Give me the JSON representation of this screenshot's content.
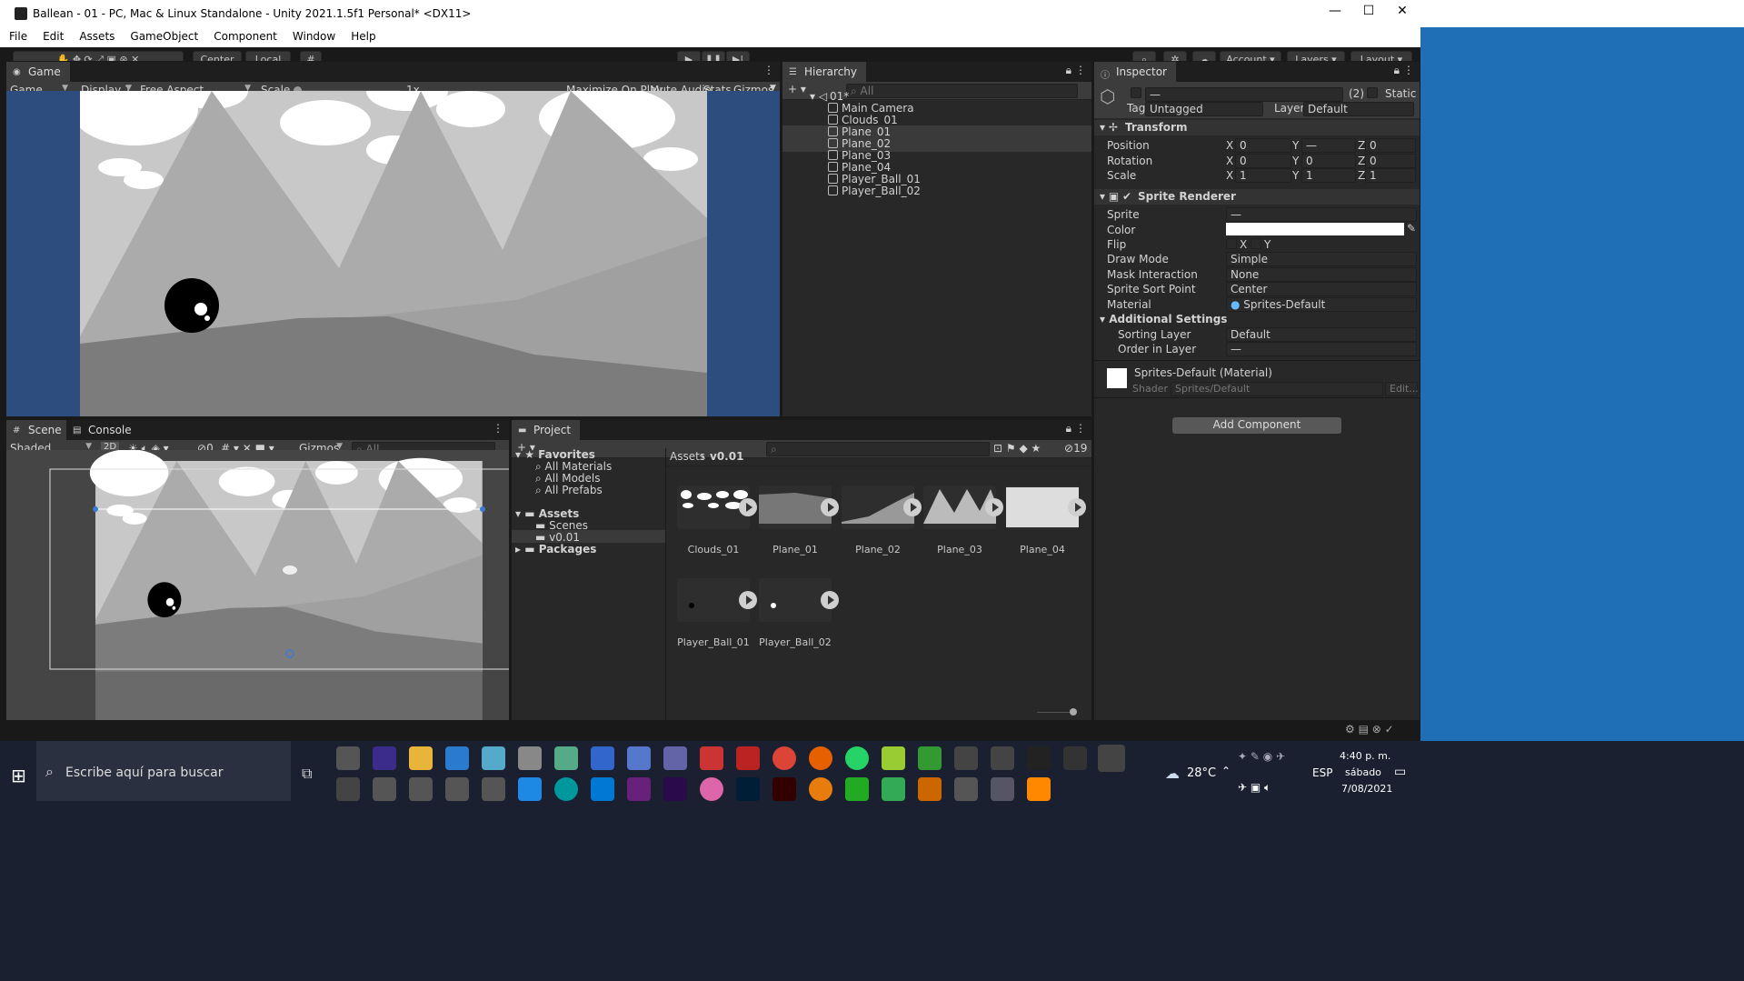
{
  "window": {
    "title": "Ballean - 01 - PC, Mac & Linux Standalone - Unity 2021.1.5f1 Personal* <DX11>",
    "minimize": "—",
    "maximize": "☐",
    "close": "✕"
  },
  "menu": [
    "File",
    "Edit",
    "Assets",
    "GameObject",
    "Component",
    "Window",
    "Help"
  ],
  "toolbar": {
    "pivot": "Center",
    "space": "Local",
    "account": "Account",
    "layers": "Layers",
    "layout": "Layout"
  },
  "game": {
    "tab": "Game",
    "view": "Game",
    "display": "Display 1",
    "aspect": "Free Aspect",
    "scale_label": "Scale",
    "scale_value": "1x",
    "maximize": "Maximize On Play",
    "mute": "Mute Audio",
    "stats": "Stats",
    "gizmos": "Gizmos"
  },
  "scene": {
    "tab": "Scene",
    "console_tab": "Console",
    "shading": "Shaded",
    "mode2d": "2D",
    "hidden_count": "0",
    "gizmos": "Gizmos",
    "search": "All"
  },
  "hierarchy": {
    "tab": "Hierarchy",
    "search": "All",
    "scene": "01*",
    "items": [
      "Main Camera",
      "Clouds_01",
      "Plane_01",
      "Plane_02",
      "Plane_03",
      "Plane_04",
      "Player_Ball_01",
      "Player_Ball_02"
    ]
  },
  "project": {
    "tab": "Project",
    "favorites": "Favorites",
    "fav_items": [
      "All Materials",
      "All Models",
      "All Prefabs"
    ],
    "assets": "Assets",
    "folders": [
      "Scenes",
      "v0.01"
    ],
    "packages": "Packages",
    "breadcrumb_root": "Assets",
    "breadcrumb_leaf": "v0.01",
    "count": "19",
    "asset_items": [
      "Clouds_01",
      "Plane_01",
      "Plane_02",
      "Plane_03",
      "Plane_04",
      "Player_Ball_01",
      "Player_Ball_02"
    ]
  },
  "inspector": {
    "tab": "Inspector",
    "name": "—",
    "count": "(2)",
    "static": "Static",
    "tag_label": "Tag",
    "tag": "Untagged",
    "layer_label": "Layer",
    "layer": "Default",
    "transform": {
      "title": "Transform",
      "position": "Position",
      "rotation": "Rotation",
      "scale": "Scale",
      "pos": {
        "x": "0",
        "y": "—",
        "z": "0"
      },
      "rot": {
        "x": "0",
        "y": "0",
        "z": "0"
      },
      "scl": {
        "x": "1",
        "y": "1",
        "z": "1"
      },
      "xl": "X",
      "yl": "Y",
      "zl": "Z"
    },
    "sprite": {
      "title": "Sprite Renderer",
      "sprite": "Sprite",
      "sprite_val": "—",
      "color": "Color",
      "flip": "Flip",
      "flip_x": "X",
      "flip_y": "Y",
      "draw_mode": "Draw Mode",
      "draw_mode_val": "Simple",
      "mask": "Mask Interaction",
      "mask_val": "None",
      "sort_point": "Sprite Sort Point",
      "sort_point_val": "Center",
      "material": "Material",
      "material_val": "Sprites-Default",
      "additional": "Additional Settings",
      "sorting_layer": "Sorting Layer",
      "sorting_layer_val": "Default",
      "order": "Order in Layer",
      "order_val": "—"
    },
    "mat": {
      "title": "Sprites-Default (Material)",
      "shader_label": "Shader",
      "shader": "Sprites/Default",
      "edit": "Edit..."
    },
    "add_component": "Add Component"
  },
  "taskbar": {
    "search": "Escribe aquí para buscar",
    "temp": "28°C",
    "lang": "ESP",
    "time": "4:40 p. m.",
    "day": "sábado",
    "date": "7/08/2021"
  },
  "colors": {
    "editor_bg": "#282828",
    "game_bg": "#2d4d7e",
    "select": "#3e5e8a"
  }
}
